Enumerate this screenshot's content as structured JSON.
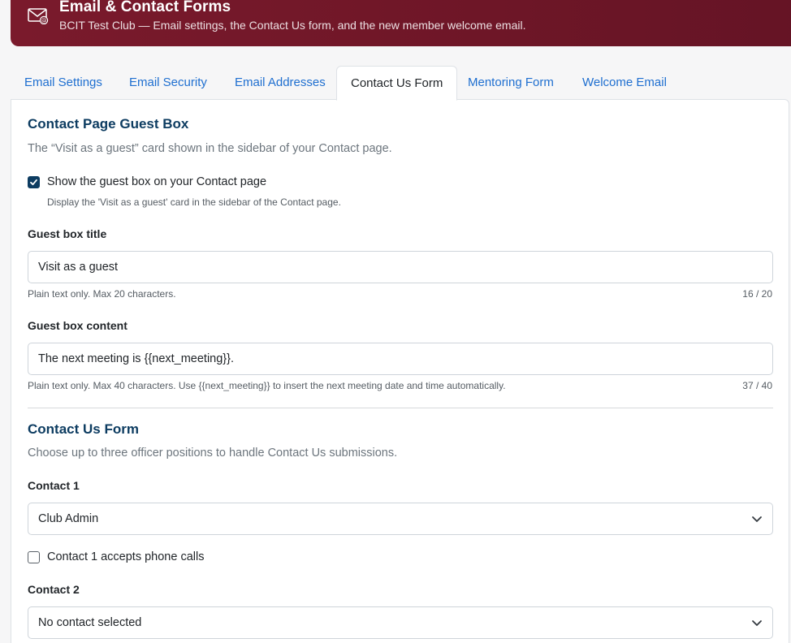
{
  "header": {
    "title": "Email & Contact Forms",
    "subtitle": "BCIT Test Club — Email settings, the Contact Us form, and the new member welcome email.",
    "icon": "envelope-at-icon"
  },
  "tabs": [
    {
      "label": "Email Settings",
      "active": false
    },
    {
      "label": "Email Security",
      "active": false
    },
    {
      "label": "Email Addresses",
      "active": false
    },
    {
      "label": "Contact Us Form",
      "active": true
    },
    {
      "label": "Mentoring Form",
      "active": false
    },
    {
      "label": "Welcome Email",
      "active": false
    }
  ],
  "guest_box": {
    "title": "Contact Page Guest Box",
    "description": "The “Visit as a guest” card shown in the sidebar of your Contact page.",
    "show_checkbox": {
      "label": "Show the guest box on your Contact page",
      "checked": true,
      "help": "Display the 'Visit as a guest' card in the sidebar of the Contact page."
    },
    "title_field": {
      "label": "Guest box title",
      "value": "Visit as a guest",
      "help": "Plain text only. Max 20 characters.",
      "counter": "16 / 20"
    },
    "content_field": {
      "label": "Guest box content",
      "value": "The next meeting is {{next_meeting}}.",
      "help": "Plain text only. Max 40 characters. Use {{next_meeting}} to insert the next meeting date and time automatically.",
      "counter": "37 / 40"
    }
  },
  "contact_form": {
    "title": "Contact Us Form",
    "description": "Choose up to three officer positions to handle Contact Us submissions.",
    "contact1": {
      "label": "Contact 1",
      "selected": "Club Admin",
      "phone_checkbox": {
        "label": "Contact 1 accepts phone calls",
        "checked": false
      }
    },
    "contact2": {
      "label": "Contact 2",
      "selected": "No contact selected"
    }
  },
  "colors": {
    "brand_header": "#7a1a2c",
    "section_title": "#0d3c61",
    "tab_link": "#1f6fd0",
    "checkbox_checked": "#0d3c61"
  }
}
